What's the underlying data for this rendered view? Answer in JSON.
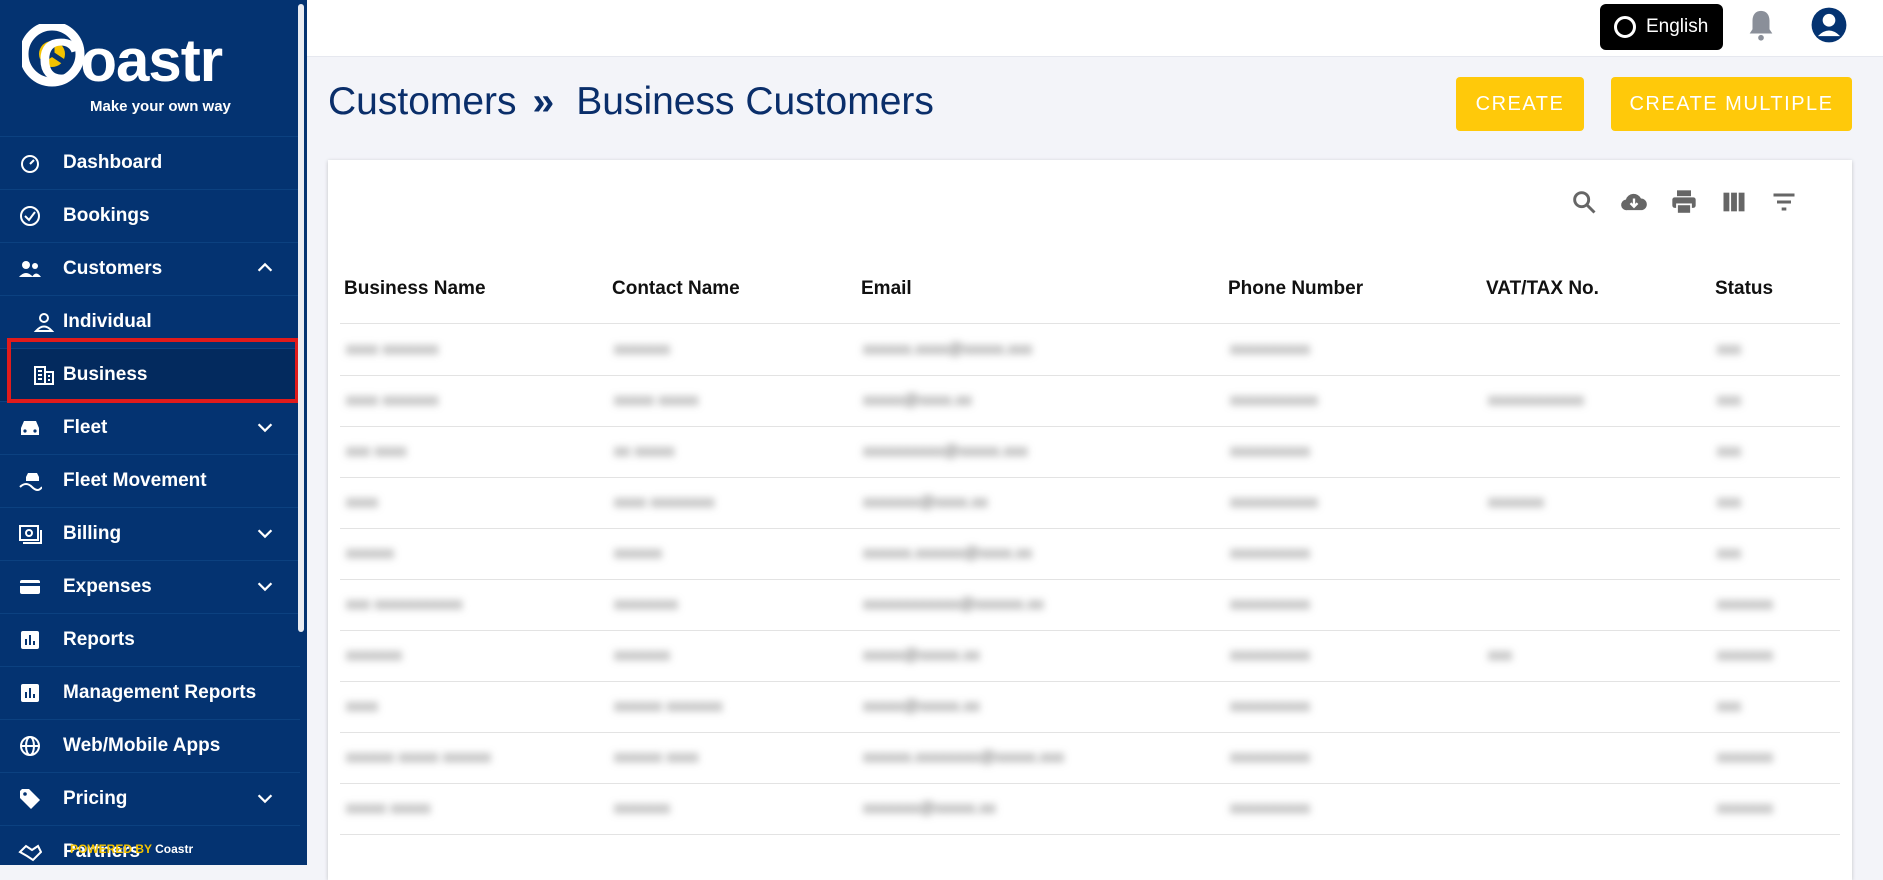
{
  "brand": {
    "name": "Coastr",
    "tagline": "Make your own way",
    "powered_prefix": "POWERED BY",
    "powered_brand": "Coastr"
  },
  "header": {
    "language": "English"
  },
  "breadcrumb": {
    "parent": "Customers",
    "separator": "»",
    "current": "Business Customers"
  },
  "actions": {
    "create": "CREATE",
    "create_multiple": "CREATE MULTIPLE"
  },
  "sidebar": {
    "items": [
      {
        "label": "Dashboard",
        "icon": "dashboard-icon"
      },
      {
        "label": "Bookings",
        "icon": "check-circle-icon"
      },
      {
        "label": "Customers",
        "icon": "people-icon",
        "expanded": true
      },
      {
        "label": "Individual",
        "icon": "person-icon",
        "sub": true
      },
      {
        "label": "Business",
        "icon": "building-icon",
        "sub": true,
        "active": true
      },
      {
        "label": "Fleet",
        "icon": "car-icon"
      },
      {
        "label": "Fleet Movement",
        "icon": "car-move-icon"
      },
      {
        "label": "Billing",
        "icon": "billing-icon"
      },
      {
        "label": "Expenses",
        "icon": "card-icon"
      },
      {
        "label": "Reports",
        "icon": "chart-icon"
      },
      {
        "label": "Management Reports",
        "icon": "chart-icon"
      },
      {
        "label": "Web/Mobile Apps",
        "icon": "globe-icon"
      },
      {
        "label": "Pricing",
        "icon": "tag-icon"
      },
      {
        "label": "Partners",
        "icon": "handshake-icon"
      }
    ]
  },
  "table": {
    "columns": [
      "Business Name",
      "Contact Name",
      "Email",
      "Phone Number",
      "VAT/TAX No.",
      "Status"
    ],
    "rows": [
      [
        "xxxx xxxxxxx",
        "xxxxxxx",
        "xxxxxx.xxxx@xxxxx.xxx",
        "xxxxxxxxxx",
        "",
        "xxx"
      ],
      [
        "xxxx xxxxxxx",
        "xxxxx xxxxx",
        "xxxxx@xxxx.xx",
        "xxxxxxxxxxx",
        "xxxxxxxxxxxx",
        "xxx"
      ],
      [
        "xxx xxxx",
        "xx xxxxx",
        "xxxxxxxxxx@xxxxx.xxx",
        "xxxxxxxxxx",
        "",
        "xxx"
      ],
      [
        "xxxx",
        "xxxx xxxxxxxx",
        "xxxxxxx@xxxx.xx",
        "xxxxxxxxxxx",
        "xxxxxxx",
        "xxx"
      ],
      [
        "xxxxxx",
        "xxxxxx",
        "xxxxxx.xxxxxx@xxxx.xx",
        "xxxxxxxxxx",
        "",
        "xxx"
      ],
      [
        "xxx xxxxxxxxxxx",
        "xxxxxxxx",
        "xxxxxxxxxxxx@xxxxxx.xx",
        "xxxxxxxxxx",
        "",
        "xxxxxxx"
      ],
      [
        "xxxxxxx",
        "xxxxxxx",
        "xxxxx@xxxxx.xx",
        "xxxxxxxxxx",
        "xxx",
        "xxxxxxx"
      ],
      [
        "xxxx",
        "xxxxxx xxxxxxx",
        "xxxxx@xxxxx.xx",
        "xxxxxxxxxx",
        "",
        "xxx"
      ],
      [
        "xxxxxx xxxxx xxxxxx",
        "xxxxxx xxxx",
        "xxxxxx.xxxxxxxx@xxxxx.xxx",
        "xxxxxxxxxx",
        "",
        "xxxxxxx"
      ],
      [
        "xxxxx xxxxx",
        "xxxxxxx",
        "xxxxxxx@xxxxx.xx",
        "xxxxxxxxxx",
        "",
        "xxxxxxx"
      ]
    ]
  },
  "colors": {
    "sidebar": "#043371",
    "accent": "#ffc90a",
    "highlight": "#e11b1b"
  }
}
